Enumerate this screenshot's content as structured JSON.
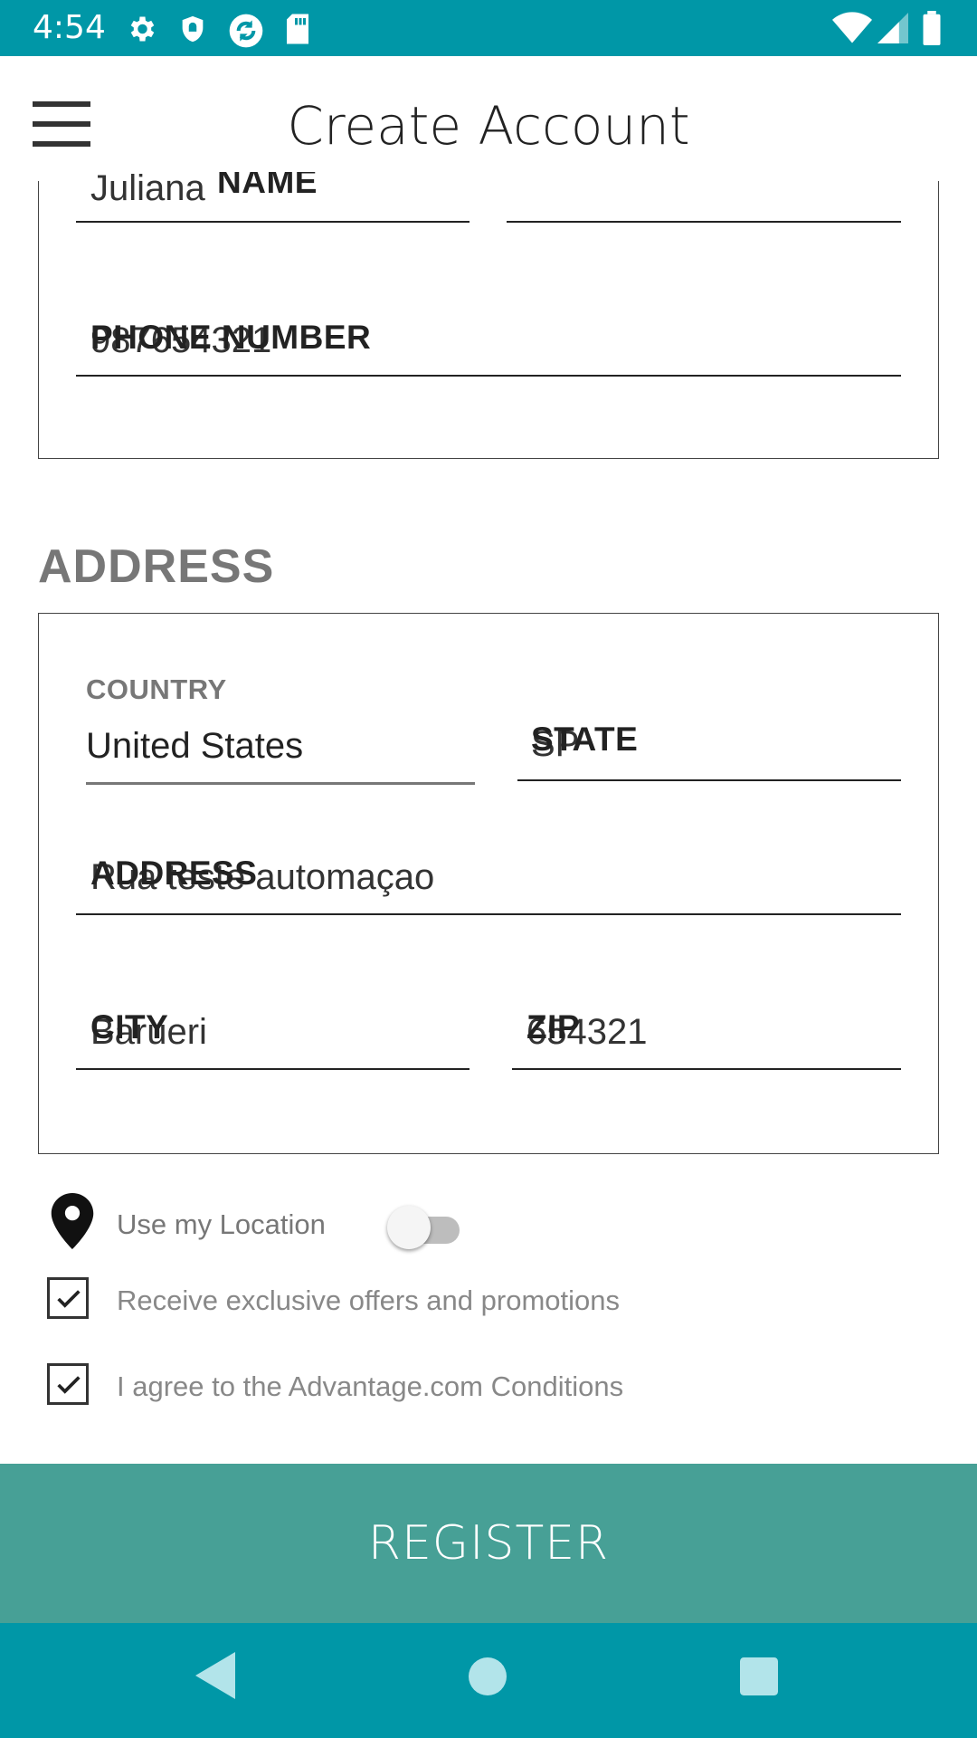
{
  "status_bar": {
    "time": "4:54",
    "icons_left": [
      "settings-icon",
      "shield-icon",
      "sync-icon",
      "sd-card-icon"
    ],
    "icons_right": [
      "wifi-icon",
      "signal-icon",
      "battery-icon"
    ]
  },
  "app_bar": {
    "title": "Create Account",
    "menu_icon": "hamburger-menu-icon"
  },
  "account_section": {
    "fields": [
      {
        "label": "LAST NAME",
        "value": "Juliana",
        "partial_label": "NAME"
      },
      {
        "label": "",
        "value": ""
      },
      {
        "label": "PHONE NUMBER",
        "value": "987654321"
      }
    ]
  },
  "address_section": {
    "heading": "ADDRESS",
    "country": {
      "label": "COUNTRY",
      "value": "United States"
    },
    "state": {
      "label": "STATE",
      "value": "SP"
    },
    "address": {
      "label": "ADDRESS",
      "value": "Rua teste automaçao"
    },
    "city": {
      "label": "CITY",
      "value": "Barueri"
    },
    "zip": {
      "label": "ZIP",
      "value": "654321"
    }
  },
  "options": {
    "use_location": {
      "label": "Use my Location",
      "enabled": false,
      "icon": "location-pin-icon"
    },
    "offers": {
      "label": "Receive exclusive offers and promotions",
      "checked": true
    },
    "conditions": {
      "label": "I agree to the Advantage.com Conditions",
      "checked": true
    }
  },
  "register_button": {
    "label": "REGISTER"
  },
  "nav_bar": {
    "buttons": [
      "back-icon",
      "home-icon",
      "recents-icon"
    ]
  },
  "colors": {
    "status_bar": "#0097a7",
    "register_button": "#47a096",
    "nav_bar": "#0097a7"
  }
}
